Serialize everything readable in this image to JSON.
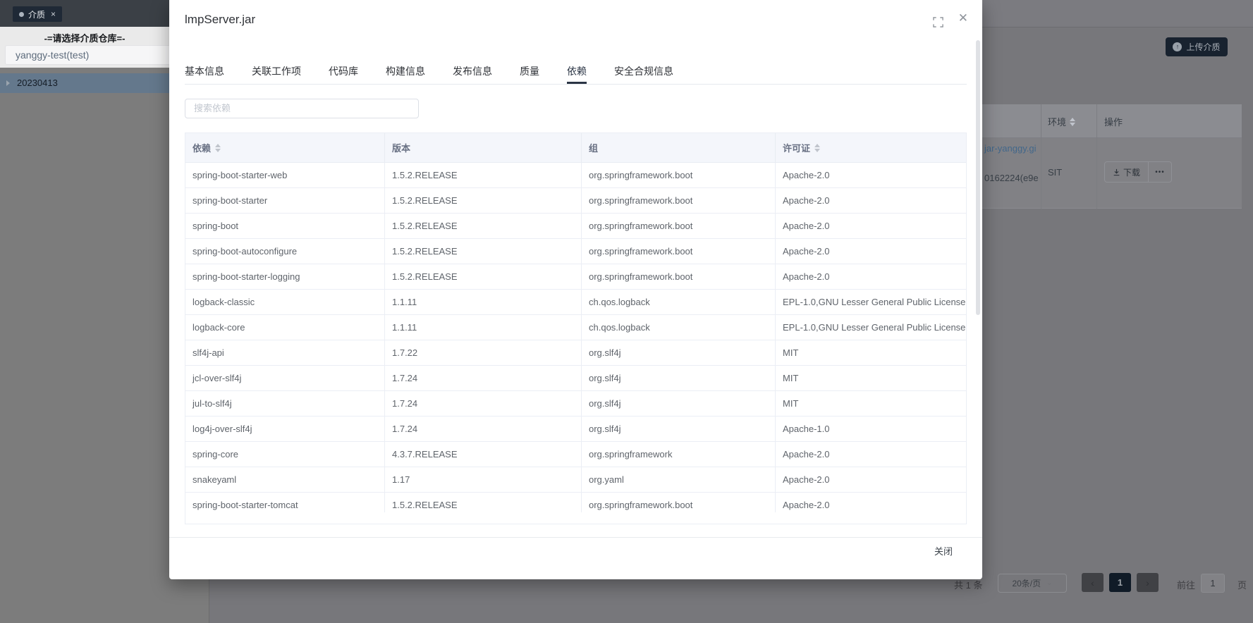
{
  "topbar": {
    "tag": {
      "label": "介质",
      "close_glyph": "×"
    }
  },
  "sidebar": {
    "title": "-=请选择介质仓库=-",
    "repo_select": {
      "value": "yanggy-test(test)"
    },
    "tree_item": {
      "label": "20230413",
      "selected": true
    }
  },
  "background": {
    "upload_button": {
      "label": "上传介质",
      "arrow_glyph": "↑"
    },
    "table": {
      "columns": [
        {
          "label": "环境",
          "sortable": true
        },
        {
          "label": "操作",
          "sortable": false
        }
      ],
      "row": {
        "link_line1": "jar-yanggy.gi",
        "link_line2": "0162224(e9e",
        "env": "SIT",
        "download_label": "下载",
        "more_glyph": "•••"
      }
    },
    "pagination": {
      "total": "共 1 条",
      "page_size": "20条/页",
      "size_chevron": "⌄",
      "prev_glyph": "‹",
      "next_glyph": "›",
      "current_page": "1",
      "goto_prefix": "前往",
      "goto_value": "1",
      "goto_suffix": "页"
    }
  },
  "modal": {
    "title": "lmpServer.jar",
    "close_glyph": "✕",
    "tabs": [
      {
        "label": "基本信息",
        "active": false
      },
      {
        "label": "关联工作项",
        "active": false
      },
      {
        "label": "代码库",
        "active": false
      },
      {
        "label": "构建信息",
        "active": false
      },
      {
        "label": "发布信息",
        "active": false
      },
      {
        "label": "质量",
        "active": false
      },
      {
        "label": "依赖",
        "active": true
      },
      {
        "label": "安全合规信息",
        "active": false
      }
    ],
    "search": {
      "placeholder": "搜索依赖"
    },
    "table": {
      "columns": [
        {
          "label": "依赖",
          "sortable": true
        },
        {
          "label": "版本",
          "sortable": false
        },
        {
          "label": "组",
          "sortable": false
        },
        {
          "label": "许可证",
          "sortable": true
        }
      ],
      "rows": [
        [
          "spring-boot-starter-web",
          "1.5.2.RELEASE",
          "org.springframework.boot",
          "Apache-2.0"
        ],
        [
          "spring-boot-starter",
          "1.5.2.RELEASE",
          "org.springframework.boot",
          "Apache-2.0"
        ],
        [
          "spring-boot",
          "1.5.2.RELEASE",
          "org.springframework.boot",
          "Apache-2.0"
        ],
        [
          "spring-boot-autoconfigure",
          "1.5.2.RELEASE",
          "org.springframework.boot",
          "Apache-2.0"
        ],
        [
          "spring-boot-starter-logging",
          "1.5.2.RELEASE",
          "org.springframework.boot",
          "Apache-2.0"
        ],
        [
          "logback-classic",
          "1.1.11",
          "ch.qos.logback",
          "EPL-1.0,GNU Lesser General Public License"
        ],
        [
          "logback-core",
          "1.1.11",
          "ch.qos.logback",
          "EPL-1.0,GNU Lesser General Public License"
        ],
        [
          "slf4j-api",
          "1.7.22",
          "org.slf4j",
          "MIT"
        ],
        [
          "jcl-over-slf4j",
          "1.7.24",
          "org.slf4j",
          "MIT"
        ],
        [
          "jul-to-slf4j",
          "1.7.24",
          "org.slf4j",
          "MIT"
        ],
        [
          "log4j-over-slf4j",
          "1.7.24",
          "org.slf4j",
          "Apache-1.0"
        ],
        [
          "spring-core",
          "4.3.7.RELEASE",
          "org.springframework",
          "Apache-2.0"
        ],
        [
          "snakeyaml",
          "1.17",
          "org.yaml",
          "Apache-2.0"
        ],
        [
          "spring-boot-starter-tomcat",
          "1.5.2.RELEASE",
          "org.springframework.boot",
          "Apache-2.0"
        ]
      ]
    },
    "footer": {
      "close_label": "关闭"
    }
  },
  "colors": {
    "accent_dark": "#2b3545",
    "tag_chip": "#1f2936",
    "selected_tree_row": "#64788c",
    "table_header_bg": "#f4f6fb",
    "table_border": "#ebeef5",
    "link": "#42678a",
    "overlay_backdrop": "#77777b"
  }
}
